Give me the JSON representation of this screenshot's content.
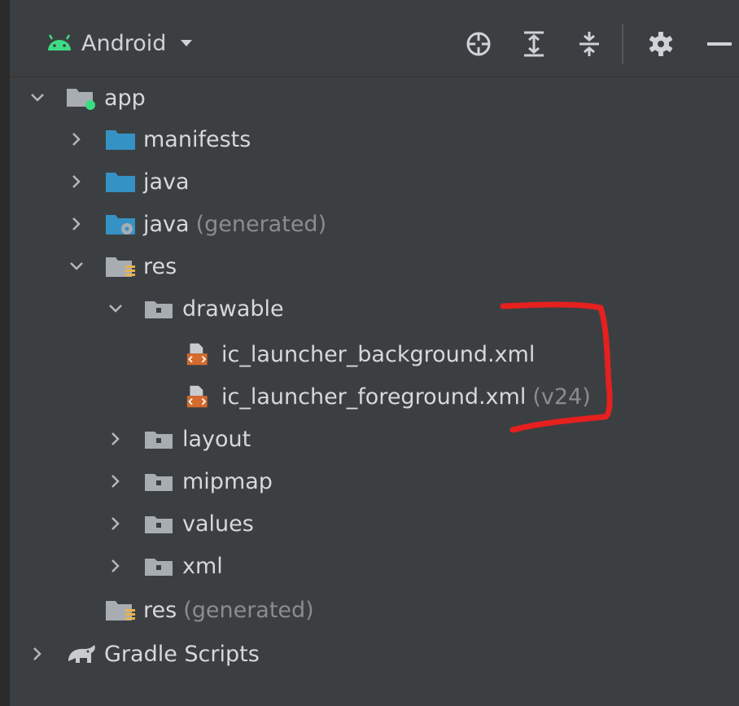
{
  "toolbar": {
    "view_label": "Android",
    "icons": [
      "target-icon",
      "expand-all-icon",
      "collapse-all-icon",
      "gear-icon",
      "minimize-icon"
    ]
  },
  "tree": {
    "app": {
      "label": "app"
    },
    "manifests": {
      "label": "manifests"
    },
    "java": {
      "label": "java"
    },
    "java_generated": {
      "label": "java",
      "suffix": "(generated)"
    },
    "res": {
      "label": "res"
    },
    "drawable": {
      "label": "drawable"
    },
    "ic_bg": {
      "label": "ic_launcher_background.xml"
    },
    "ic_fg": {
      "label": "ic_launcher_foreground.xml",
      "suffix": "(v24)"
    },
    "layout": {
      "label": "layout"
    },
    "mipmap": {
      "label": "mipmap"
    },
    "values": {
      "label": "values"
    },
    "xml": {
      "label": "xml"
    },
    "res_generated": {
      "label": "res",
      "suffix": "(generated)"
    },
    "gradle": {
      "label": "Gradle Scripts"
    }
  },
  "colors": {
    "background": "#3c3f41",
    "text": "#d6d8da",
    "muted": "#8a8d90",
    "folder_blue": "#3592c4",
    "folder_gray": "#a8adb2",
    "xml_orange": "#d46a2e",
    "annotation_red": "#e5201f",
    "android_green": "#3ddc84"
  }
}
